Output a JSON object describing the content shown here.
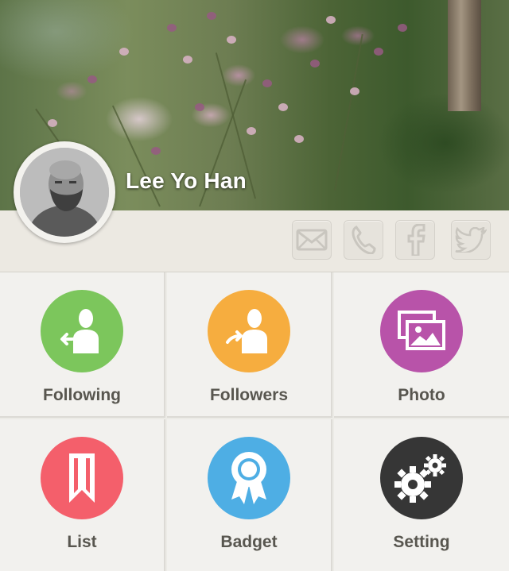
{
  "profile": {
    "name": "Lee Yo Han"
  },
  "social": [
    {
      "icon": "mail-icon"
    },
    {
      "icon": "phone-icon"
    },
    {
      "icon": "facebook-icon"
    },
    {
      "icon": "twitter-icon"
    }
  ],
  "menu": [
    {
      "label": "Following",
      "icon": "following-icon",
      "color": "#7cc65c"
    },
    {
      "label": "Followers",
      "icon": "followers-icon",
      "color": "#f6ad3f"
    },
    {
      "label": "Photo",
      "icon": "photo-icon",
      "color": "#b853a9"
    },
    {
      "label": "List",
      "icon": "bookmark-icon",
      "color": "#f45f6b"
    },
    {
      "label": "Badget",
      "icon": "badge-icon",
      "color": "#4eaee4"
    },
    {
      "label": "Setting",
      "icon": "gears-icon",
      "color": "#363636"
    }
  ]
}
